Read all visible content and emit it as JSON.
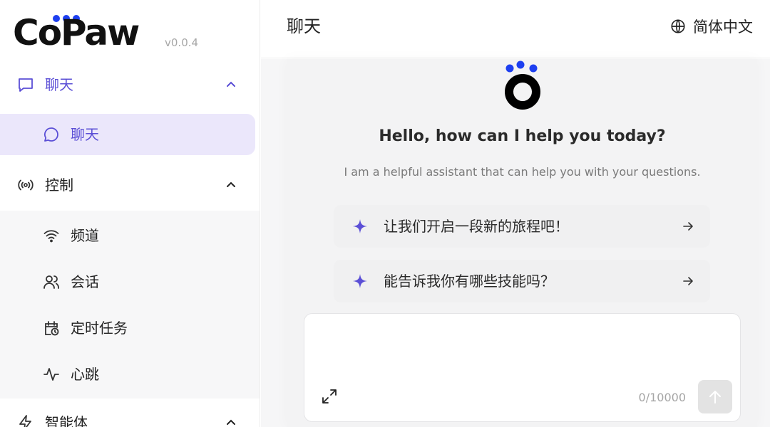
{
  "brand": {
    "name": "CoPaw",
    "version": "v0.0.4"
  },
  "sidebar": {
    "groups": [
      {
        "label": "聊天",
        "icon": "message-square-icon"
      },
      {
        "label": "控制",
        "icon": "broadcast-icon"
      },
      {
        "label": "智能体",
        "icon": "agent-icon"
      }
    ],
    "items": [
      {
        "label": "聊天",
        "icon": "message-circle-icon",
        "active": true
      },
      {
        "label": "频道",
        "icon": "wifi-icon"
      },
      {
        "label": "会话",
        "icon": "users-icon"
      },
      {
        "label": "定时任务",
        "icon": "calendar-clock-icon"
      },
      {
        "label": "心跳",
        "icon": "activity-icon"
      }
    ]
  },
  "header": {
    "title": "聊天",
    "language": "简体中文"
  },
  "welcome": {
    "greeting": "Hello, how can I help you today?",
    "subtitle": "I am a helpful assistant that can help you with your questions."
  },
  "prompts": [
    {
      "text": "让我们开启一段新的旅程吧！"
    },
    {
      "text": "能告诉我你有哪些技能吗？"
    }
  ],
  "composer": {
    "value": "",
    "placeholder": "",
    "counter": "0/10000"
  },
  "colors": {
    "accent": "#5b4fd6",
    "active_bg": "#ebe7fb",
    "logo_dots": "#1d3ff0"
  }
}
